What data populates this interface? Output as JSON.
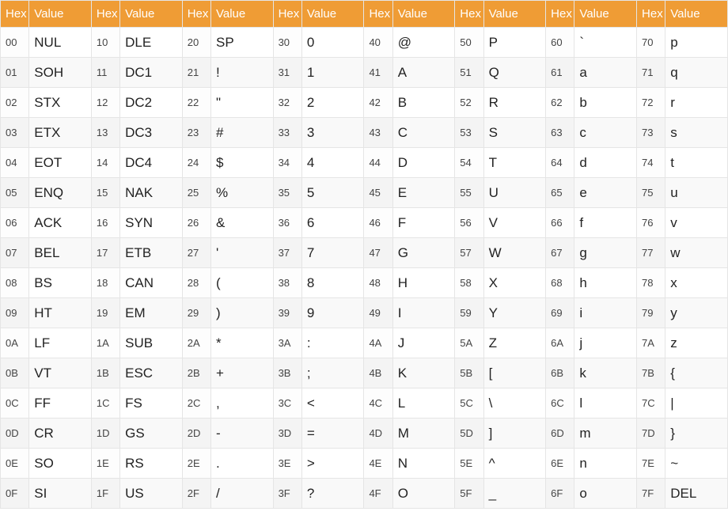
{
  "headers": {
    "hex": "Hex",
    "value": "Value"
  },
  "columns": [
    [
      [
        "00",
        "NUL"
      ],
      [
        "01",
        "SOH"
      ],
      [
        "02",
        "STX"
      ],
      [
        "03",
        "ETX"
      ],
      [
        "04",
        "EOT"
      ],
      [
        "05",
        "ENQ"
      ],
      [
        "06",
        "ACK"
      ],
      [
        "07",
        "BEL"
      ],
      [
        "08",
        "BS"
      ],
      [
        "09",
        "HT"
      ],
      [
        "0A",
        "LF"
      ],
      [
        "0B",
        "VT"
      ],
      [
        "0C",
        "FF"
      ],
      [
        "0D",
        "CR"
      ],
      [
        "0E",
        "SO"
      ],
      [
        "0F",
        "SI"
      ]
    ],
    [
      [
        "10",
        "DLE"
      ],
      [
        "11",
        "DC1"
      ],
      [
        "12",
        "DC2"
      ],
      [
        "13",
        "DC3"
      ],
      [
        "14",
        "DC4"
      ],
      [
        "15",
        "NAK"
      ],
      [
        "16",
        "SYN"
      ],
      [
        "17",
        "ETB"
      ],
      [
        "18",
        "CAN"
      ],
      [
        "19",
        "EM"
      ],
      [
        "1A",
        "SUB"
      ],
      [
        "1B",
        "ESC"
      ],
      [
        "1C",
        "FS"
      ],
      [
        "1D",
        "GS"
      ],
      [
        "1E",
        "RS"
      ],
      [
        "1F",
        "US"
      ]
    ],
    [
      [
        "20",
        "SP"
      ],
      [
        "21",
        "!"
      ],
      [
        "22",
        "\""
      ],
      [
        "23",
        "#"
      ],
      [
        "24",
        "$"
      ],
      [
        "25",
        "%"
      ],
      [
        "26",
        "&"
      ],
      [
        "27",
        "'"
      ],
      [
        "28",
        "("
      ],
      [
        "29",
        ")"
      ],
      [
        "2A",
        "*"
      ],
      [
        "2B",
        "+"
      ],
      [
        "2C",
        ","
      ],
      [
        "2D",
        "-"
      ],
      [
        "2E",
        "."
      ],
      [
        "2F",
        "/"
      ]
    ],
    [
      [
        "30",
        "0"
      ],
      [
        "31",
        "1"
      ],
      [
        "32",
        "2"
      ],
      [
        "33",
        "3"
      ],
      [
        "34",
        "4"
      ],
      [
        "35",
        "5"
      ],
      [
        "36",
        "6"
      ],
      [
        "37",
        "7"
      ],
      [
        "38",
        "8"
      ],
      [
        "39",
        "9"
      ],
      [
        "3A",
        ":"
      ],
      [
        "3B",
        ";"
      ],
      [
        "3C",
        "<"
      ],
      [
        "3D",
        "="
      ],
      [
        "3E",
        ">"
      ],
      [
        "3F",
        "?"
      ]
    ],
    [
      [
        "40",
        "@"
      ],
      [
        "41",
        "A"
      ],
      [
        "42",
        "B"
      ],
      [
        "43",
        "C"
      ],
      [
        "44",
        "D"
      ],
      [
        "45",
        "E"
      ],
      [
        "46",
        "F"
      ],
      [
        "47",
        "G"
      ],
      [
        "48",
        "H"
      ],
      [
        "49",
        "I"
      ],
      [
        "4A",
        "J"
      ],
      [
        "4B",
        "K"
      ],
      [
        "4C",
        "L"
      ],
      [
        "4D",
        "M"
      ],
      [
        "4E",
        "N"
      ],
      [
        "4F",
        "O"
      ]
    ],
    [
      [
        "50",
        "P"
      ],
      [
        "51",
        "Q"
      ],
      [
        "52",
        "R"
      ],
      [
        "53",
        "S"
      ],
      [
        "54",
        "T"
      ],
      [
        "55",
        "U"
      ],
      [
        "56",
        "V"
      ],
      [
        "57",
        "W"
      ],
      [
        "58",
        "X"
      ],
      [
        "59",
        "Y"
      ],
      [
        "5A",
        "Z"
      ],
      [
        "5B",
        "["
      ],
      [
        "5C",
        "\\"
      ],
      [
        "5D",
        "]"
      ],
      [
        "5E",
        "^"
      ],
      [
        "5F",
        "_"
      ]
    ],
    [
      [
        "60",
        "`"
      ],
      [
        "61",
        "a"
      ],
      [
        "62",
        "b"
      ],
      [
        "63",
        "c"
      ],
      [
        "64",
        "d"
      ],
      [
        "65",
        "e"
      ],
      [
        "66",
        "f"
      ],
      [
        "67",
        "g"
      ],
      [
        "68",
        "h"
      ],
      [
        "69",
        "i"
      ],
      [
        "6A",
        "j"
      ],
      [
        "6B",
        "k"
      ],
      [
        "6C",
        "l"
      ],
      [
        "6D",
        "m"
      ],
      [
        "6E",
        "n"
      ],
      [
        "6F",
        "o"
      ]
    ],
    [
      [
        "70",
        "p"
      ],
      [
        "71",
        "q"
      ],
      [
        "72",
        "r"
      ],
      [
        "73",
        "s"
      ],
      [
        "74",
        "t"
      ],
      [
        "75",
        "u"
      ],
      [
        "76",
        "v"
      ],
      [
        "77",
        "w"
      ],
      [
        "78",
        "x"
      ],
      [
        "79",
        "y"
      ],
      [
        "7A",
        "z"
      ],
      [
        "7B",
        "{"
      ],
      [
        "7C",
        "|"
      ],
      [
        "7D",
        "}"
      ],
      [
        "7E",
        "~"
      ],
      [
        "7F",
        "DEL"
      ]
    ]
  ]
}
